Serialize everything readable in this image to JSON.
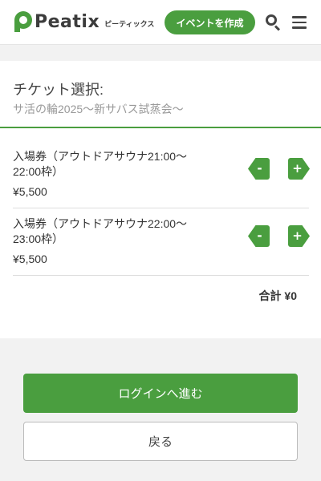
{
  "header": {
    "logo_text": "Peatix",
    "logo_sub": "ピーティックス",
    "create_event_label": "イベントを作成"
  },
  "page": {
    "title": "チケット選択:",
    "event_name": "サ活の輪2025〜新サバス試蒸会〜"
  },
  "tickets": [
    {
      "name": "入場券（アウトドアサウナ21:00〜22:00枠）",
      "price": "¥5,500",
      "minus": "-",
      "plus": "+"
    },
    {
      "name": "入場券（アウトドアサウナ22:00〜23:00枠）",
      "price": "¥5,500",
      "minus": "-",
      "plus": "+"
    }
  ],
  "total": {
    "label": "合計 ¥0"
  },
  "actions": {
    "login_label": "ログインへ進む",
    "back_label": "戻る"
  },
  "colors": {
    "accent": "#4a9e3f",
    "background": "#f2f2f2"
  }
}
